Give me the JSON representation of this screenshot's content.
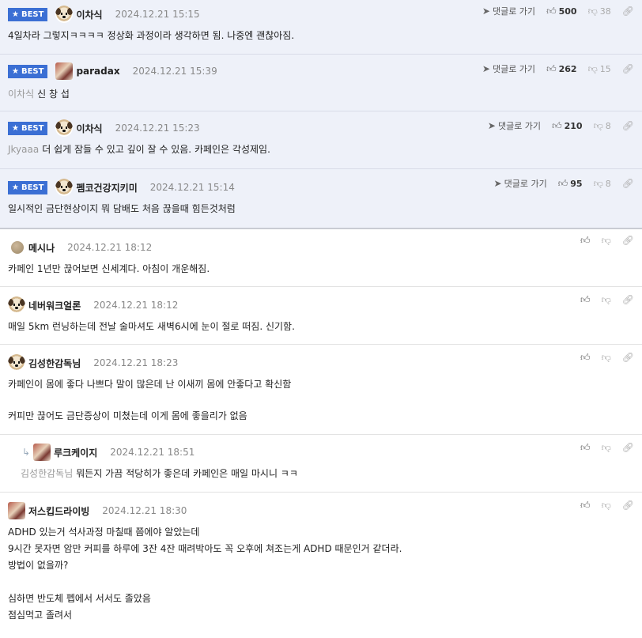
{
  "best_badge": "BEST",
  "reply_label": "댓글로 가기",
  "comments": [
    {
      "nick": "이차식",
      "date": "2024.12.21 15:15",
      "up": "500",
      "down": "38",
      "mention": "",
      "body": "4일차라 그렇지ㅋㅋㅋㅋ 정상화 과정이라 생각하면 됨. 나중엔 괜찮아짐."
    },
    {
      "nick": "paradax",
      "date": "2024.12.21 15:39",
      "up": "262",
      "down": "15",
      "mention": "이차식",
      "body": "신 창 섭"
    },
    {
      "nick": "이차식",
      "date": "2024.12.21 15:23",
      "up": "210",
      "down": "8",
      "mention": "Jkyaaa",
      "body": "더 쉽게 잠들 수 있고 깊이 잘 수 있음. 카페인은 각성제임."
    },
    {
      "nick": "펨코건강지키미",
      "date": "2024.12.21 15:14",
      "up": "95",
      "down": "8",
      "mention": "",
      "body": "일시적인 금단현상이지 뭐 담배도 처음 끊을때 힘든것처럼"
    },
    {
      "nick": "메시나",
      "date": "2024.12.21 18:12",
      "mention": "",
      "body": "카페인 1년만 끊어보면 신세계다. 아침이 개운해짐."
    },
    {
      "nick": "네버워크얼론",
      "date": "2024.12.21 18:12",
      "mention": "",
      "body": "매일 5km 런닝하는데 전날 술마셔도 새벽6시에 눈이 절로 떠짐. 신기함."
    },
    {
      "nick": "김성한감독님",
      "date": "2024.12.21 18:23",
      "mention": "",
      "body": "카페인이 몸에 좋다 나쁘다 말이 많은데 난 이새끼 몸에 안좋다고 확신함\n\n커피만 끊어도 금단증상이 미쳤는데 이게 몸에 좋을리가 없음"
    },
    {
      "nick": "루크케이지",
      "date": "2024.12.21 18:51",
      "mention": "김성한감독님",
      "body": "뭐든지 가끔 적당히가 좋은데 카페인은 매일 마시니 ㅋㅋ"
    },
    {
      "nick": "저스킵드라이빙",
      "date": "2024.12.21 18:30",
      "mention": "",
      "body": "ADHD 있는거 석사과정 마칠때 쯤에야 알았는데\n9시간 못자면 암만 커피를 하루에 3잔 4잔 때려박아도 꼭 오후에 쳐조는게 ADHD 때문인거 같더라.\n방법이 없을까?\n\n심하면 반도체 펩에서 서서도 졸았음\n점심먹고 졸려서"
    }
  ]
}
